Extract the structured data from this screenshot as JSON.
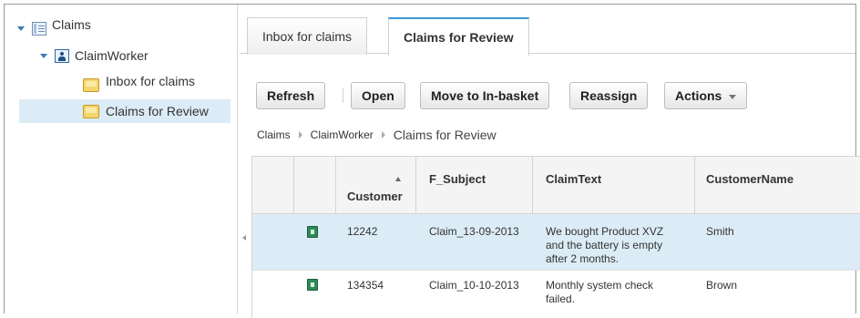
{
  "tree": {
    "root_label": "Claims",
    "worker_label": "ClaimWorker",
    "items": [
      {
        "label": "Inbox for claims"
      },
      {
        "label": "Claims for Review"
      }
    ]
  },
  "tabs": [
    {
      "label": "Inbox for claims"
    },
    {
      "label": "Claims for Review"
    }
  ],
  "toolbar": {
    "refresh": "Refresh",
    "open": "Open",
    "move": "Move to In-basket",
    "reassign": "Reassign",
    "actions": "Actions"
  },
  "breadcrumb": {
    "level1": "Claims",
    "level2": "ClaimWorker",
    "current": "Claims for Review"
  },
  "grid": {
    "columns": [
      "Customer",
      "F_Subject",
      "ClaimText",
      "CustomerName"
    ],
    "rows": [
      {
        "customer": "12242",
        "subject": "Claim_13-09-2013",
        "text_lines": [
          "We bought Product XVZ",
          "and the battery is empty",
          "after 2 months."
        ],
        "name": "Smith"
      },
      {
        "customer": "134354",
        "subject": "Claim_10-10-2013",
        "text_lines": [
          "Monthly system check",
          "failed."
        ],
        "name": "Brown"
      }
    ]
  },
  "colors": {
    "accent": "#3b9bd9",
    "selection": "#dcecf6"
  }
}
